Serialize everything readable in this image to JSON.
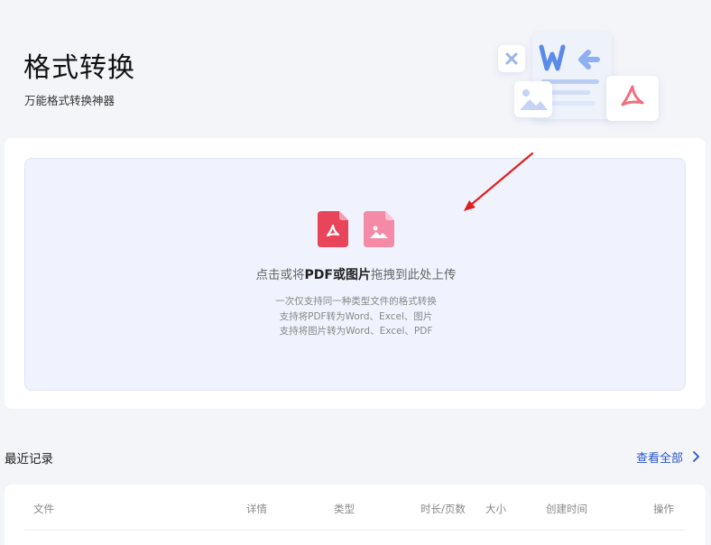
{
  "header": {
    "title": "格式转换",
    "subtitle": "万能格式转换神器"
  },
  "hero": {
    "icons": [
      "excel-x-icon",
      "word-w-icon",
      "image-icon",
      "pdf-icon"
    ]
  },
  "upload": {
    "main_prefix": "点击或将",
    "main_highlight": "PDF或图片",
    "main_suffix": "拖拽到此处上传",
    "hint_line1": "一次仅支持同一种类型文件的格式转换",
    "hint_line2": "支持将PDF转为Word、Excel、图片",
    "hint_line3": "支持将图片转为Word、Excel、PDF",
    "icons": [
      "pdf-file-icon",
      "image-file-icon"
    ]
  },
  "recent": {
    "title": "最近记录",
    "view_all": "查看全部",
    "columns": [
      "文件",
      "详情",
      "类型",
      "时长/页数",
      "大小",
      "创建时间",
      "操作"
    ]
  },
  "colors": {
    "accent": "#2a56c6",
    "pdf_red": "#e8455a",
    "image_pink": "#f27a99",
    "drop_bg": "#f0f3fd",
    "annotation_red": "#e02020"
  }
}
